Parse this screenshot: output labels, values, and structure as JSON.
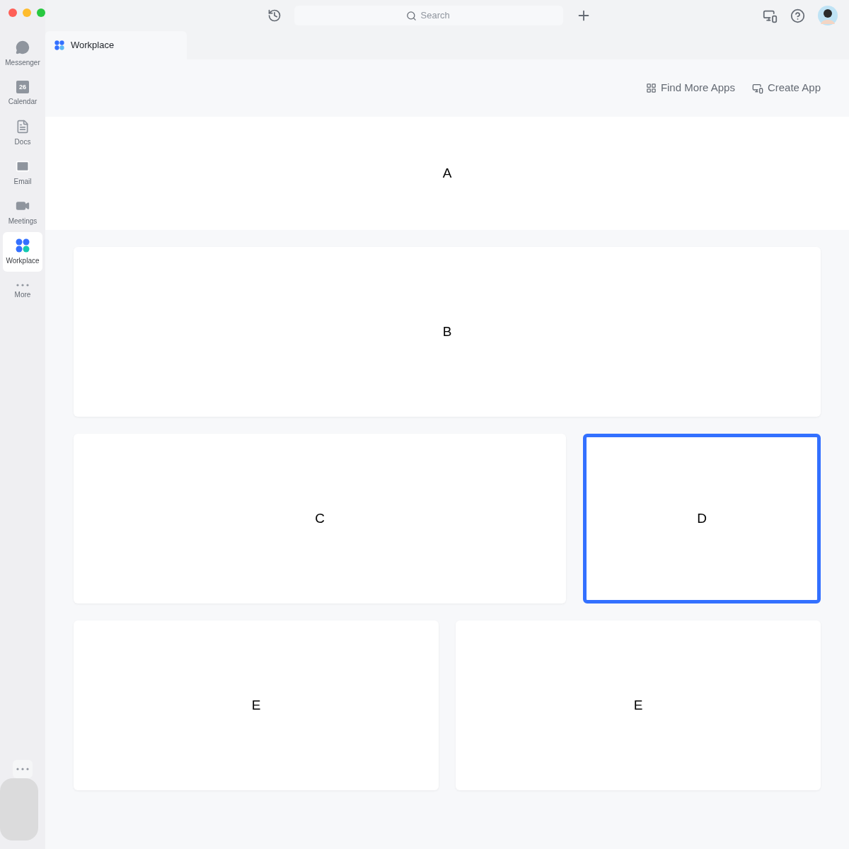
{
  "window": {
    "search": {
      "placeholder": "Search"
    }
  },
  "sidebar": {
    "items": [
      {
        "label": "Messenger",
        "selected": false
      },
      {
        "label": "Calendar",
        "selected": false,
        "date": "26"
      },
      {
        "label": "Docs",
        "selected": false
      },
      {
        "label": "Email",
        "selected": false
      },
      {
        "label": "Meetings",
        "selected": false
      },
      {
        "label": "Workplace",
        "selected": true
      },
      {
        "label": "More",
        "selected": false
      }
    ]
  },
  "tabs": [
    {
      "label": "Workplace",
      "selected": true
    }
  ],
  "toolbar": [
    "Find More Apps",
    "Create App"
  ],
  "banner": {
    "label": "A"
  },
  "panel_rows": [
    [
      {
        "label": "B",
        "selected": false
      }
    ],
    [
      {
        "label": "C",
        "selected": false
      },
      {
        "label": "D",
        "selected": true
      }
    ],
    [
      {
        "label": "E",
        "selected": false
      },
      {
        "label": "E",
        "selected": false
      }
    ]
  ]
}
